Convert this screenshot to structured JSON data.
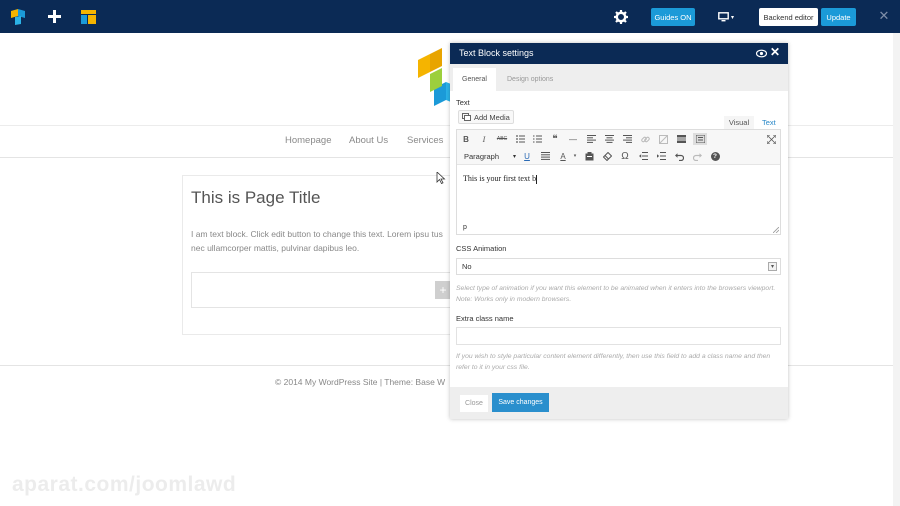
{
  "toolbar": {
    "guides_label": "Guides ON",
    "backend_label": "Backend editor",
    "update_label": "Update",
    "close_glyph": "✕",
    "device_chevron": "▾",
    "icons": [
      "vc-logo-icon",
      "plus-icon",
      "layout-icon",
      "gear-icon",
      "monitor-icon",
      "close-icon"
    ]
  },
  "site": {
    "nav": [
      "Homepage",
      "About Us",
      "Services"
    ],
    "page_title": "This is Page Title",
    "page_text": "I am text block. Click edit button to change this text. Lorem ipsu tus nec ullamcorper mattis, pulvinar dapibus leo.",
    "add_glyph": "+",
    "footer": "© 2014 My WordPress Site | Theme: Base W"
  },
  "modal": {
    "title": "Text Block settings",
    "close_glyph": "✕",
    "tabs": [
      "General",
      "Design options"
    ],
    "text_label": "Text",
    "add_media_label": "Add Media",
    "mode_visual": "Visual",
    "mode_text": "Text",
    "format_select": "Paragraph",
    "editor_content": "This is your first text b",
    "editor_path": "p",
    "anim_label": "CSS Animation",
    "anim_value": "No",
    "anim_help": "Select type of animation if you want this element to be animated when it enters into the browsers viewport. Note: Works only in modern browsers.",
    "class_label": "Extra class name",
    "class_value": "",
    "class_help": "If you wish to style particular content element differently, then use this field to add a class name and then refer to it in your css file.",
    "close_label": "Close",
    "save_label": "Save changes"
  },
  "editor_tools": {
    "bold": "B",
    "italic": "I",
    "strike": "ABC",
    "quote": "❝",
    "hr": "—",
    "underline": "U",
    "textcolor": "A",
    "omega": "Ω",
    "help": "?",
    "select_caret": "▾"
  },
  "watermark": "aparat.com/joomlawd",
  "colors": {
    "topbar": "#0b2a55",
    "accent": "#1b9ad8",
    "save": "#2a8fcd"
  }
}
